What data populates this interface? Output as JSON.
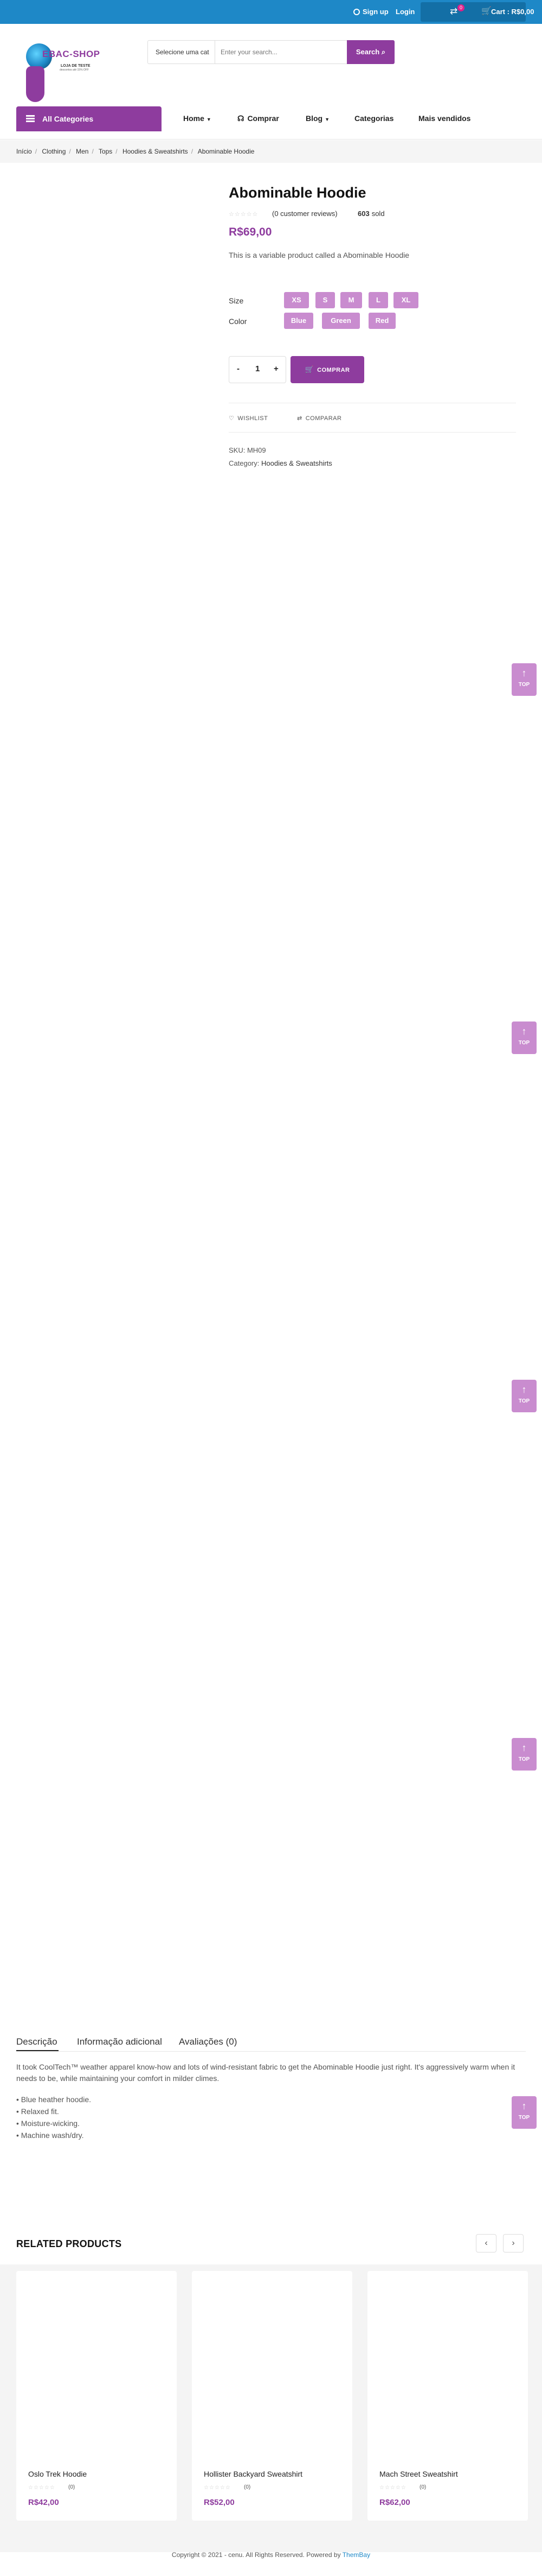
{
  "topbar": {
    "signup": "Sign up",
    "login": "Login",
    "wishlist_count": "0",
    "compare_count": "0",
    "cart_label": "Cart : R$0,00",
    "cart_count": "0"
  },
  "header": {
    "logo_title": "EBAC-SHOP",
    "logo_subtitle": "LOJA DE TESTE",
    "logo_tagline": "descontos até 15% OFF",
    "search_category": "Selecione uma cat",
    "search_placeholder": "Enter your search...",
    "search_button": "Search"
  },
  "nav": {
    "all_categories": "All Categories",
    "items": [
      "Home",
      "Comprar",
      "Blog",
      "Categorias",
      "Mais vendidos"
    ]
  },
  "breadcrumb": [
    "Início",
    "Clothing",
    "Men",
    "Tops",
    "Hoodies & Sweatshirts",
    "Abominable Hoodie"
  ],
  "product": {
    "title": "Abominable Hoodie",
    "rating": 0,
    "reviews_text": "(0 customer reviews)",
    "sold_count": "603",
    "sold_label": "sold",
    "price": "R$69,00",
    "short_description": "This is a variable product called a Abominable Hoodie",
    "size_label": "Size",
    "sizes": [
      "XS",
      "S",
      "M",
      "L",
      "XL"
    ],
    "color_label": "Color",
    "colors": [
      "Blue",
      "Green",
      "Red"
    ],
    "quantity": "1",
    "qty_minus": "-",
    "qty_plus": "+",
    "buy_button": "COMPRAR",
    "wishlist": "WISHLIST",
    "compare": "COMPARAR",
    "sku": "SKU: MH09",
    "category_prefix": "Category:",
    "category": "Hoodies & Sweatshirts"
  },
  "back_to_top": "TOP",
  "tabs": [
    "Descrição",
    "Informação adicional",
    "Avaliações (0)"
  ],
  "description": {
    "paragraph": "It took CoolTech™ weather apparel know-how and lots of wind-resistant fabric to get the Abominable Hoodie just right. It's aggressively warm when it needs to be, while maintaining your comfort in milder climes.",
    "bullets": [
      "• Blue heather hoodie.",
      "• Relaxed fit.",
      "• Moisture-wicking.",
      "• Machine wash/dry."
    ]
  },
  "related": {
    "title": "RELATED PRODUCTS",
    "prev": "‹",
    "next": "›",
    "products": [
      {
        "name": "Oslo Trek Hoodie",
        "rating_count": "(0)",
        "price": "R$42,00"
      },
      {
        "name": "Hollister Backyard Sweatshirt",
        "rating_count": "(0)",
        "price": "R$52,00"
      },
      {
        "name": "Mach Street Sweatshirt",
        "rating_count": "(0)",
        "price": "R$62,00"
      }
    ]
  },
  "footer": {
    "copyright": "Copyright © 2021 - cenu. All Rights Reserved. Powered by",
    "brand": "ThemBay"
  },
  "colors": {
    "primary": "#8e3c9e",
    "swatch": "#c98ccf",
    "topbar": "#1e88c7"
  }
}
